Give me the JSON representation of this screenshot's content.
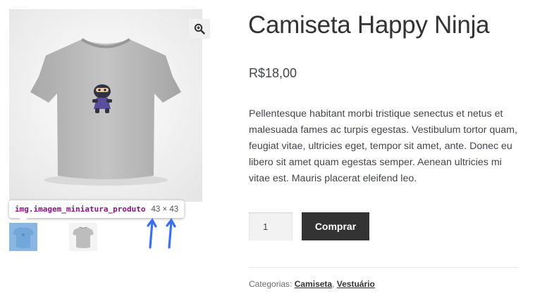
{
  "product": {
    "title": "Camiseta Happy Ninja",
    "price": "R$18,00",
    "description": "Pellentesque habitant morbi tristique senectus et netus et malesuada fames ac turpis egestas. Vestibulum tortor quam, feugiat vitae, ultricies eget, tempor sit amet, ante. Donec eu libero sit amet quam egestas semper. Aenean ultricies mi vitae est. Mauris placerat eleifend leo.",
    "quantity": "1",
    "buy_label": "Comprar",
    "categories_label": "Categorias:",
    "categories": [
      "Camiseta",
      "Vestuário"
    ],
    "category_separator": ", "
  },
  "gallery": {
    "zoom_icon": "magnifier-plus-icon",
    "thumbnail_count": 2
  },
  "devtools_tooltip": {
    "selector_tag": "img",
    "selector_class": ".imagem_miniatura_produto",
    "size": "43 × 43"
  },
  "colors": {
    "button_bg": "#333333",
    "highlight_overlay": "#6fa8dc",
    "annotation_arrow": "#3b6ff5",
    "selector_color": "#881280"
  }
}
